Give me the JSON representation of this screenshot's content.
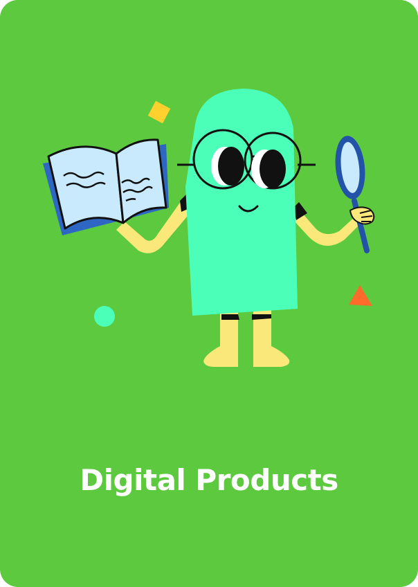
{
  "card": {
    "title": "Digital Products"
  },
  "colors": {
    "background": "#5CC93E",
    "character_body": "#4BFFB8",
    "skin": "#FBE87A",
    "book_page": "#C9EAFC",
    "book_cover": "#2E66C4",
    "magnifier": "#2253A8",
    "confetti_square": "#FFD12E",
    "confetti_triangle": "#FF6B2B",
    "confetti_circle": "#4BFFB8",
    "title_text": "#FFFFFF"
  },
  "illustration": {
    "subject": "character-reading-book-with-magnifying-glass",
    "icons": [
      "book-icon",
      "magnifying-glass-icon",
      "glasses-icon"
    ]
  }
}
